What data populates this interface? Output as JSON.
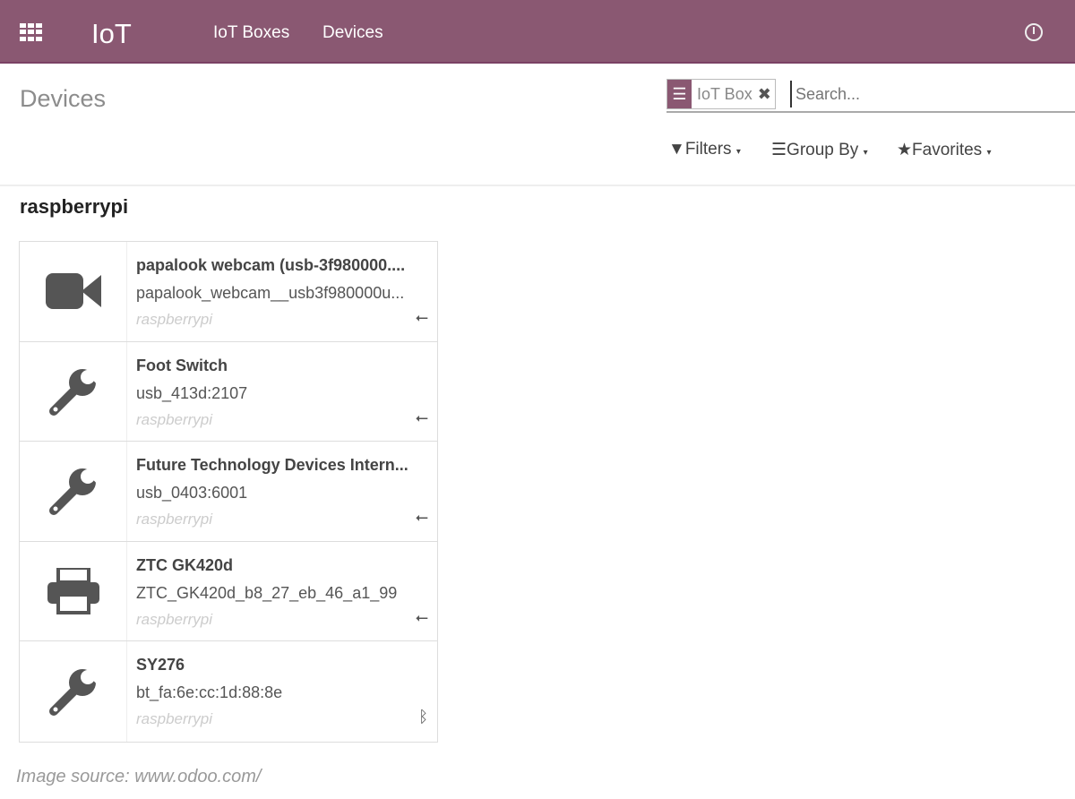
{
  "header": {
    "app": "IoT",
    "menu": [
      "IoT Boxes",
      "Devices"
    ],
    "accent": "#8a5872"
  },
  "page": {
    "title": "Devices"
  },
  "search": {
    "facet": "IoT Box",
    "placeholder": "Search..."
  },
  "tools": {
    "filters": "Filters",
    "group_by": "Group By",
    "favorites": "Favorites"
  },
  "group": "raspberrypi",
  "devices": [
    {
      "name": "papalook webcam (usb-3f980000....",
      "identifier": "papalook_webcam__usb3f980000u...",
      "box": "raspberrypi",
      "icon": "video-camera-icon",
      "connection": "usb-icon"
    },
    {
      "name": "Foot Switch",
      "identifier": "usb_413d:2107",
      "box": "raspberrypi",
      "icon": "wrench-icon",
      "connection": "usb-icon"
    },
    {
      "name": "Future Technology Devices Intern...",
      "identifier": "usb_0403:6001",
      "box": "raspberrypi",
      "icon": "wrench-icon",
      "connection": "usb-icon"
    },
    {
      "name": "ZTC GK420d",
      "identifier": "ZTC_GK420d_b8_27_eb_46_a1_99",
      "box": "raspberrypi",
      "icon": "printer-icon",
      "connection": "usb-icon"
    },
    {
      "name": "SY276",
      "identifier": "bt_fa:6e:cc:1d:88:8e",
      "box": "raspberrypi",
      "icon": "wrench-icon",
      "connection": "bluetooth-icon"
    }
  ],
  "credit": "Image source: www.odoo.com/"
}
